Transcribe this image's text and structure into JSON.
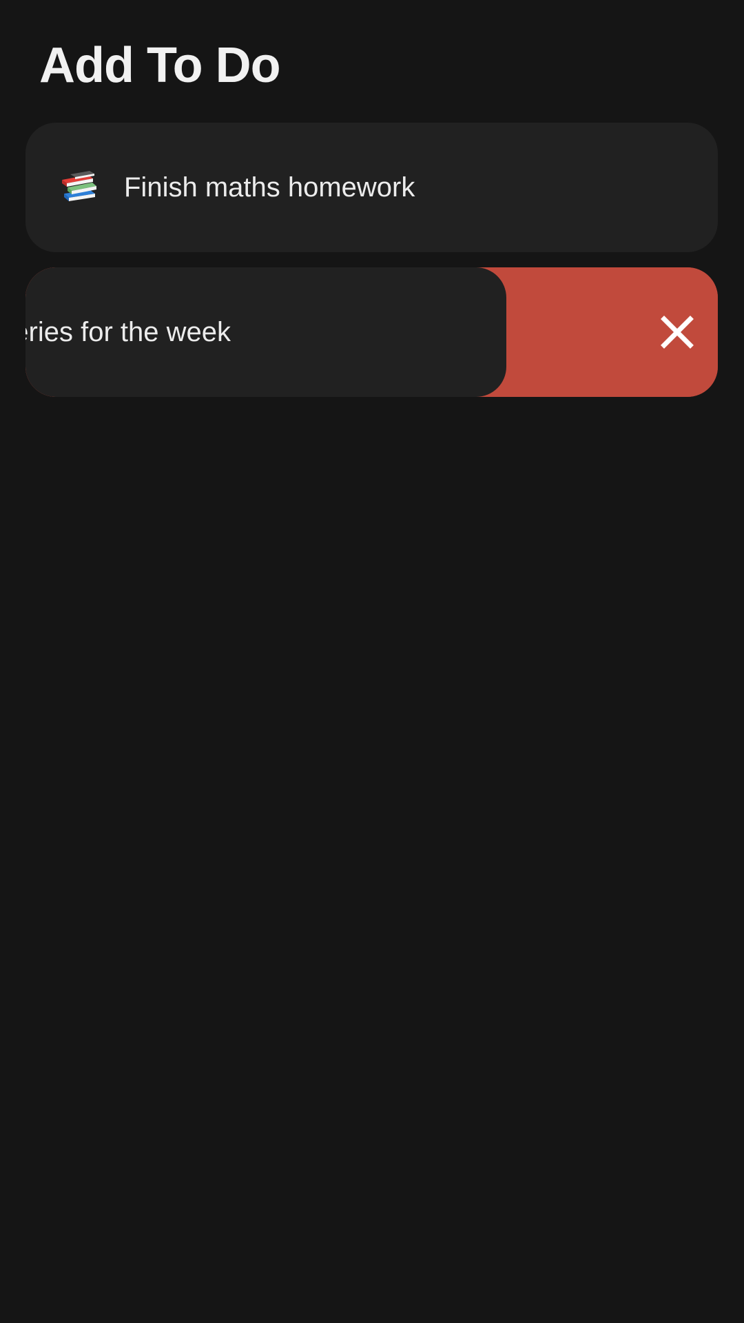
{
  "header": {
    "title": "Add To Do"
  },
  "todos": [
    {
      "icon": "books-emoji-icon",
      "text": "Finish maths homework"
    },
    {
      "text": "Buy groceries for the week",
      "swipe_state": "swiped-left",
      "action_icon": "close-icon"
    }
  ],
  "colors": {
    "background": "#151515",
    "card": "#212121",
    "delete": "#c14a3c",
    "text": "#ececec",
    "title": "#f1f1f1"
  }
}
